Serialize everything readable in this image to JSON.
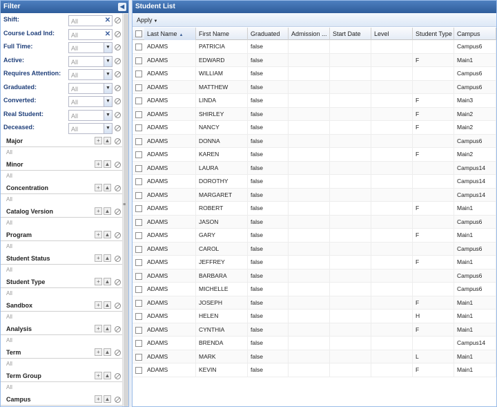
{
  "filter": {
    "title": "Filter",
    "fields": [
      {
        "label": "Shift:",
        "value": "All",
        "clearable": true
      },
      {
        "label": "Course Load Ind:",
        "value": "All",
        "clearable": true
      },
      {
        "label": "Full Time:",
        "value": "All",
        "clearable": false
      },
      {
        "label": "Active:",
        "value": "All",
        "clearable": false
      },
      {
        "label": "Requires Attention:",
        "value": "All",
        "clearable": false
      },
      {
        "label": "Graduated:",
        "value": "All",
        "clearable": false
      },
      {
        "label": "Converted:",
        "value": "All",
        "clearable": false
      },
      {
        "label": "Real Student:",
        "value": "All",
        "clearable": false
      },
      {
        "label": "Deceased:",
        "value": "All",
        "clearable": false
      }
    ],
    "groups": [
      {
        "title": "Major",
        "value": "All"
      },
      {
        "title": "Minor",
        "value": "All"
      },
      {
        "title": "Concentration",
        "value": "All"
      },
      {
        "title": "Catalog Version",
        "value": "All"
      },
      {
        "title": "Program",
        "value": "All"
      },
      {
        "title": "Student Status",
        "value": "All"
      },
      {
        "title": "Student Type",
        "value": "All"
      },
      {
        "title": "Sandbox",
        "value": "All"
      },
      {
        "title": "Analysis",
        "value": "All"
      },
      {
        "title": "Term",
        "value": "All"
      },
      {
        "title": "Term Group",
        "value": "All"
      },
      {
        "title": "Campus",
        "value": ""
      }
    ]
  },
  "list": {
    "title": "Student List",
    "apply_label": "Apply",
    "columns": [
      "Last Name",
      "First Name",
      "Graduated",
      "Admission ...",
      "Start Date",
      "Level",
      "Student Type",
      "Campus"
    ],
    "sorted_column": "Last Name",
    "rows": [
      [
        "ADAMS",
        "PATRICIA",
        "false",
        "",
        "",
        "",
        "",
        "Campus6"
      ],
      [
        "ADAMS",
        "EDWARD",
        "false",
        "",
        "",
        "",
        "F",
        "Main1"
      ],
      [
        "ADAMS",
        "WILLIAM",
        "false",
        "",
        "",
        "",
        "",
        "Campus6"
      ],
      [
        "ADAMS",
        "MATTHEW",
        "false",
        "",
        "",
        "",
        "",
        "Campus6"
      ],
      [
        "ADAMS",
        "LINDA",
        "false",
        "",
        "",
        "",
        "F",
        "Main3"
      ],
      [
        "ADAMS",
        "SHIRLEY",
        "false",
        "",
        "",
        "",
        "F",
        "Main2"
      ],
      [
        "ADAMS",
        "NANCY",
        "false",
        "",
        "",
        "",
        "F",
        "Main2"
      ],
      [
        "ADAMS",
        "DONNA",
        "false",
        "",
        "",
        "",
        "",
        "Campus6"
      ],
      [
        "ADAMS",
        "KAREN",
        "false",
        "",
        "",
        "",
        "F",
        "Main2"
      ],
      [
        "ADAMS",
        "LAURA",
        "false",
        "",
        "",
        "",
        "",
        "Campus14"
      ],
      [
        "ADAMS",
        "DOROTHY",
        "false",
        "",
        "",
        "",
        "",
        "Campus14"
      ],
      [
        "ADAMS",
        "MARGARET",
        "false",
        "",
        "",
        "",
        "",
        "Campus14"
      ],
      [
        "ADAMS",
        "ROBERT",
        "false",
        "",
        "",
        "",
        "F",
        "Main1"
      ],
      [
        "ADAMS",
        "JASON",
        "false",
        "",
        "",
        "",
        "",
        "Campus6"
      ],
      [
        "ADAMS",
        "GARY",
        "false",
        "",
        "",
        "",
        "F",
        "Main1"
      ],
      [
        "ADAMS",
        "CAROL",
        "false",
        "",
        "",
        "",
        "",
        "Campus6"
      ],
      [
        "ADAMS",
        "JEFFREY",
        "false",
        "",
        "",
        "",
        "F",
        "Main1"
      ],
      [
        "ADAMS",
        "BARBARA",
        "false",
        "",
        "",
        "",
        "",
        "Campus6"
      ],
      [
        "ADAMS",
        "MICHELLE",
        "false",
        "",
        "",
        "",
        "",
        "Campus6"
      ],
      [
        "ADAMS",
        "JOSEPH",
        "false",
        "",
        "",
        "",
        "F",
        "Main1"
      ],
      [
        "ADAMS",
        "HELEN",
        "false",
        "",
        "",
        "",
        "H",
        "Main1"
      ],
      [
        "ADAMS",
        "CYNTHIA",
        "false",
        "",
        "",
        "",
        "F",
        "Main1"
      ],
      [
        "ADAMS",
        "BRENDA",
        "false",
        "",
        "",
        "",
        "",
        "Campus14"
      ],
      [
        "ADAMS",
        "MARK",
        "false",
        "",
        "",
        "",
        "L",
        "Main1"
      ],
      [
        "ADAMS",
        "KEVIN",
        "false",
        "",
        "",
        "",
        "F",
        "Main1"
      ]
    ]
  },
  "icons": {
    "collapse": "chevron-left-icon",
    "dropdown": "chevron-down-icon",
    "clear": "close-icon",
    "reset": "reset-icon",
    "add": "plus-icon",
    "move": "arrow-up-icon"
  }
}
